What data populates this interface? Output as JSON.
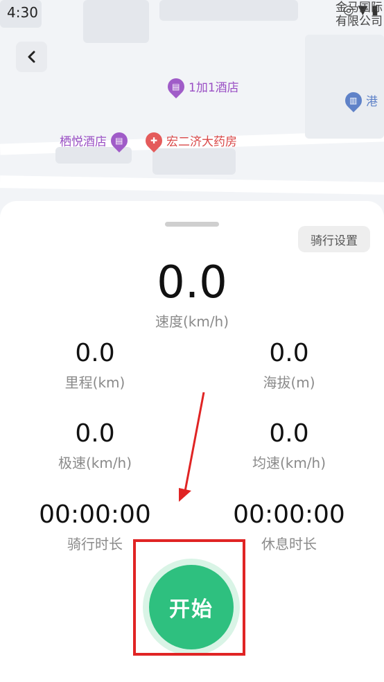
{
  "status": {
    "time": "4:30"
  },
  "map": {
    "pois": [
      {
        "label": "1加1酒店",
        "color": "#a05cc8"
      },
      {
        "label": "栖悦酒店",
        "color": "#a05cc8"
      },
      {
        "label": "宏二济大药房",
        "color": "#d94848"
      },
      {
        "label": "港",
        "color": "#5f82c8"
      },
      {
        "label": "金马国际",
        "color": "#444444"
      },
      {
        "label": "有限公司",
        "color": "#444444"
      }
    ]
  },
  "sheet": {
    "settings_label": "骑行设置",
    "speed": {
      "value": "0.0",
      "label": "速度(km/h)"
    },
    "distance": {
      "value": "0.0",
      "label": "里程(km)"
    },
    "altitude": {
      "value": "0.0",
      "label": "海拔(m)"
    },
    "max_speed": {
      "value": "0.0",
      "label": "极速(km/h)"
    },
    "avg_speed": {
      "value": "0.0",
      "label": "均速(km/h)"
    },
    "ride_time": {
      "value": "00:00:00",
      "label": "骑行时长"
    },
    "rest_time": {
      "value": "00:00:00",
      "label": "休息时长"
    },
    "start_label": "开始"
  },
  "colors": {
    "accent": "#2ec07f",
    "highlight": "#e02424"
  }
}
